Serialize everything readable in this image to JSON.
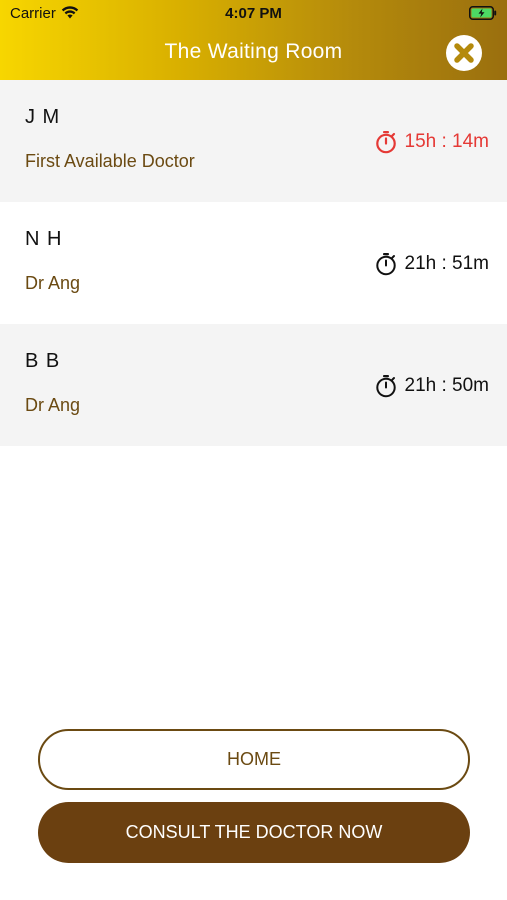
{
  "status_bar": {
    "carrier": "Carrier",
    "time": "4:07 PM",
    "wifi_icon": "wifi-icon",
    "battery_icon": "battery-charging-icon"
  },
  "header": {
    "title": "The Waiting Room",
    "close_icon": "close-circle-icon",
    "gradient_start": "#f7d600",
    "gradient_end": "#9a6f0e"
  },
  "queue": [
    {
      "name": "J M",
      "doctor": "First Available Doctor",
      "wait": "15h : 14m",
      "urgent": true
    },
    {
      "name": "N H",
      "doctor": "Dr Ang",
      "wait": "21h : 51m",
      "urgent": false
    },
    {
      "name": "B B",
      "doctor": "Dr Ang",
      "wait": "21h : 50m",
      "urgent": false
    }
  ],
  "buttons": {
    "home": "HOME",
    "consult": "CONSULT THE DOCTOR NOW"
  },
  "colors": {
    "brand_brown": "#6b4010",
    "doctor_text": "#6b4a12",
    "urgent_red": "#e53935",
    "row_alt_bg": "#f4f4f4"
  }
}
